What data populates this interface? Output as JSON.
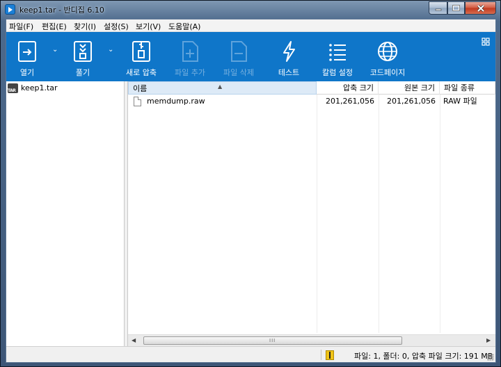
{
  "window": {
    "title_file": "keep1.tar",
    "title_app": " - 반디집 6.10"
  },
  "menu": [
    "파일(F)",
    "편집(E)",
    "찾기(I)",
    "설정(S)",
    "보기(V)",
    "도움말(A)"
  ],
  "toolbar": {
    "open": "열기",
    "extract": "풀기",
    "new_archive": "새로 압축",
    "add_file": "파일 추가",
    "delete_file": "파일 삭제",
    "test": "테스트",
    "column_settings": "칼럼 설정",
    "codepage": "코드페이지"
  },
  "tree": {
    "root": "keep1.tar"
  },
  "columns": {
    "name": "이름",
    "packed_size": "압축 크기",
    "original_size": "원본 크기",
    "file_type": "파일 종류"
  },
  "files": [
    {
      "name": "memdump.raw",
      "packed_size": "201,261,056",
      "original_size": "201,261,056",
      "file_type": "RAW 파일"
    }
  ],
  "scrollbar": {
    "grip": "III"
  },
  "status": {
    "summary": "파일: 1, 폴더: 0, 압축 파일 크기: 191 MB"
  },
  "colors": {
    "toolbar_bg": "#0f76c9",
    "accent": "#1a7fd6"
  }
}
